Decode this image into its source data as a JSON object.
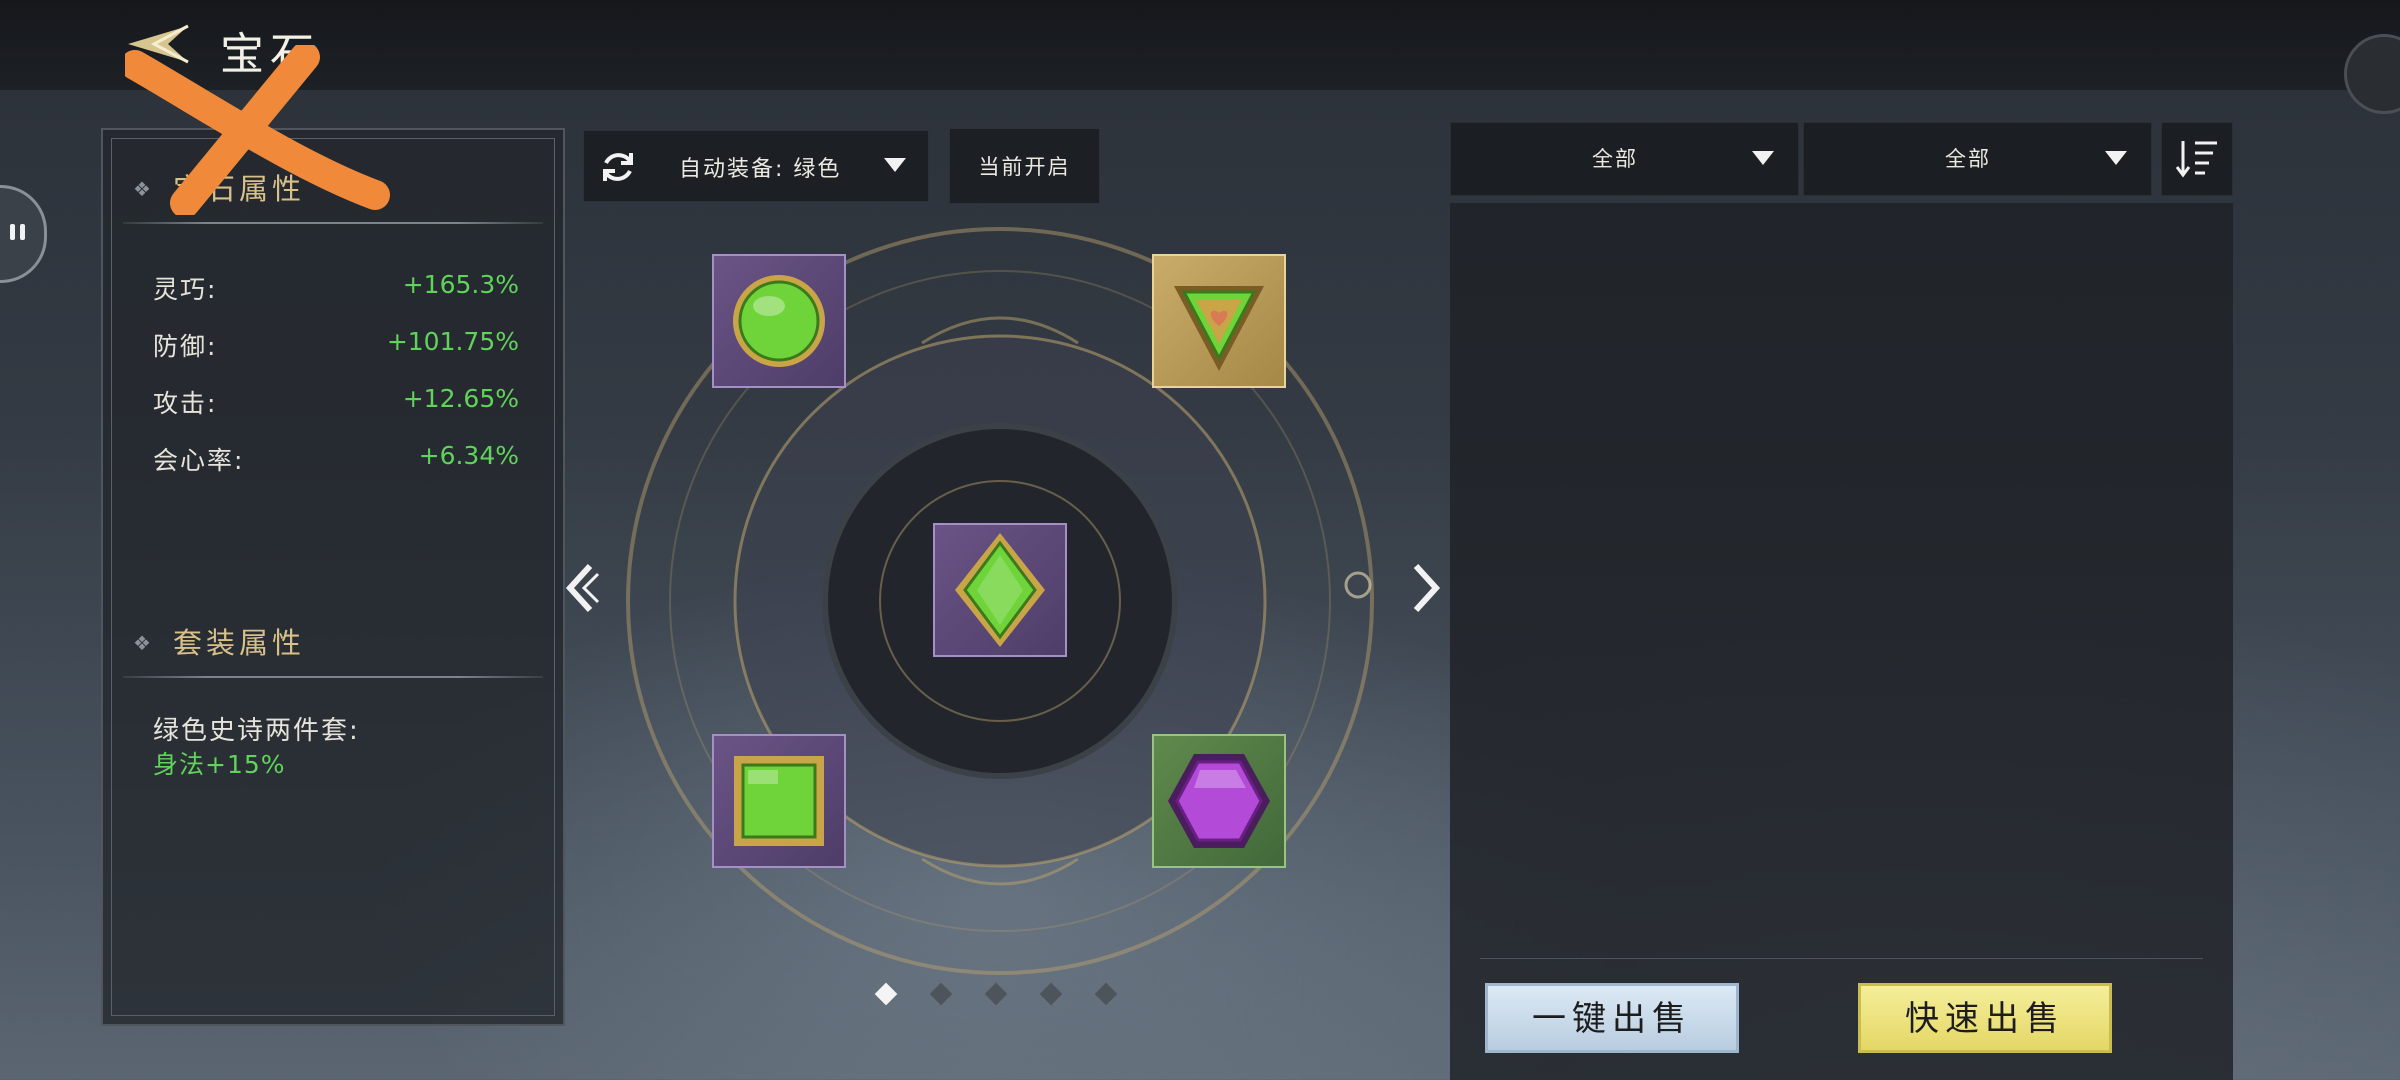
{
  "header": {
    "title": "宝石",
    "back_icon": "back-arrow-icon"
  },
  "gem_attributes": {
    "title": "宝石属性",
    "stats": [
      {
        "name": "灵巧:",
        "value": "+165.3%"
      },
      {
        "name": "防御:",
        "value": "+101.75%"
      },
      {
        "name": "攻击:",
        "value": "+12.65%"
      },
      {
        "name": "会心率:",
        "value": "+6.34%"
      }
    ]
  },
  "set_attributes": {
    "title": "套装属性",
    "set_name": "绿色史诗两件套:",
    "bonus": "身法+15%"
  },
  "toolbar": {
    "auto_equip_label": "自动装备: 绿色",
    "current_open_label": "当前开启"
  },
  "slots": [
    {
      "gem": "green-circle-gem",
      "frame": "purple"
    },
    {
      "gem": "green-triangle-heart-gem",
      "frame": "gold"
    },
    {
      "gem": "green-diamond-gem",
      "frame": "purple"
    },
    {
      "gem": "green-square-gem",
      "frame": "purple"
    },
    {
      "gem": "purple-hexagon-gem",
      "frame": "green"
    }
  ],
  "pagination": {
    "current_page": 1,
    "total_pages": 5
  },
  "filters": {
    "filter1": "全部",
    "filter2": "全部"
  },
  "actions": {
    "sell_one_click": "一键出售",
    "quick_sell": "快速出售"
  },
  "colors": {
    "stat_value": "#5fd35a",
    "section_title": "#d8c089",
    "frame_purple": "#6a5486",
    "frame_gold": "#c9ac6a",
    "frame_green": "#5f8a4c",
    "sell_blue": "#dce9f5",
    "sell_yellow": "#f5ee9a"
  }
}
